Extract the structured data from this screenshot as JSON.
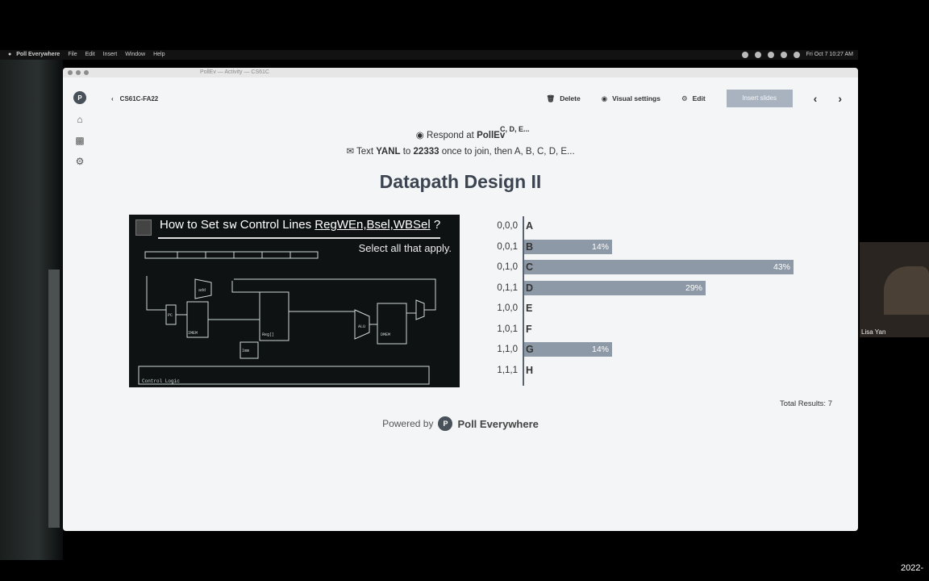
{
  "menubar": {
    "app": "Poll Everywhere",
    "items": [
      "File",
      "Edit",
      "Insert",
      "Window",
      "Help"
    ],
    "clock": "Fri Oct 7  10:27 AM"
  },
  "window": {
    "title": "PollEv — Activity — CS61C"
  },
  "nav": {
    "back_label": "CS61C-FA22",
    "delete": "Delete",
    "visual_settings": "Visual settings",
    "edit": "Edit",
    "insert_slides": "Insert slides"
  },
  "respond": {
    "line1_prefix": "Respond at",
    "line1_brand": "PollEv",
    "line2_prefix": "Text",
    "line2_code": "YANL",
    "line2_to": "to",
    "line2_number": "22333",
    "line2_suffix": "once to join, then A, B, C, D, E...",
    "overlay": "C, D, E..."
  },
  "poll_title": "Datapath Design II",
  "slide": {
    "heading_prefix": "How to Set",
    "heading_code": "sw",
    "heading_mid": "Control Lines",
    "heading_lines": "RegWEn,Bsel,WBSel",
    "heading_q": "?",
    "subheading": "Select all that apply.",
    "footer": "Control Logic"
  },
  "chart_data": {
    "type": "bar",
    "orientation": "horizontal",
    "categories": [
      "0,0,0",
      "0,0,1",
      "0,1,0",
      "0,1,1",
      "1,0,0",
      "1,0,1",
      "1,1,0",
      "1,1,1"
    ],
    "letters": [
      "A",
      "B",
      "C",
      "D",
      "E",
      "F",
      "G",
      "H"
    ],
    "values": [
      0,
      14,
      43,
      29,
      0,
      0,
      14,
      0
    ],
    "value_labels": [
      "",
      "14%",
      "43%",
      "29%",
      "",
      "",
      "14%",
      ""
    ],
    "xlim": [
      0,
      50
    ],
    "color": "#8d99a6"
  },
  "total": "Total Results: 7",
  "powered": {
    "prefix": "Powered by",
    "brand": "Poll Everywhere"
  },
  "webcam": {
    "name": "Lisa Yan"
  },
  "date_fragment": "2022-",
  "colors": {
    "window_bg": "#f4f5f6",
    "title": "#3b4450",
    "bar": "#8d99a6",
    "button": "#a9b3bf"
  }
}
